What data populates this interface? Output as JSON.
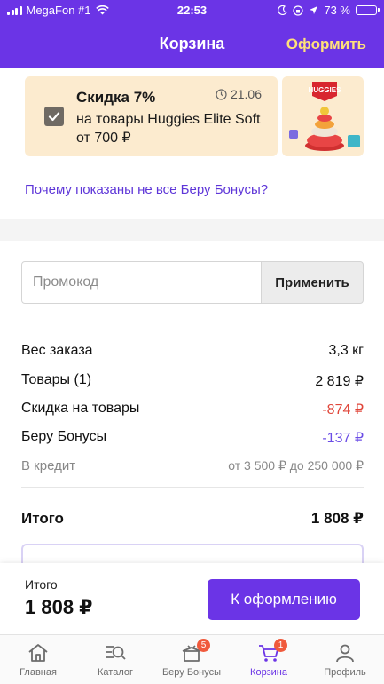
{
  "status_bar": {
    "carrier": "MegaFon #1",
    "time": "22:53",
    "battery": "73 %",
    "battery_fraction": 0.73
  },
  "nav": {
    "title": "Корзина",
    "action": "Оформить"
  },
  "promo": {
    "checked": true,
    "title": "Скидка 7%",
    "date": "21.06",
    "description": "на товары Huggies Elite Soft от 700 ₽",
    "brand": "HUGGIES"
  },
  "why_link": "Почему показаны не все Беру Бонусы?",
  "promo_code": {
    "placeholder": "Промокод",
    "value": "",
    "apply_label": "Применить"
  },
  "summary": {
    "rows": [
      {
        "label": "Вес заказа",
        "value": "3,3 кг"
      },
      {
        "label": "Товары (1)",
        "value": "2 819 ₽"
      },
      {
        "label": "Скидка на товары",
        "value": "-874 ₽"
      },
      {
        "label": "Беру Бонусы",
        "value": "-137 ₽"
      },
      {
        "label": "В кредит",
        "value": "от 3 500 ₽ до 250 000 ₽"
      }
    ],
    "total_label": "Итого",
    "total_value": "1 808 ₽"
  },
  "checkout": {
    "label": "Итого",
    "sum": "1 808 ₽",
    "button": "К оформлению"
  },
  "tabs": [
    {
      "label": "Главная",
      "icon": "home-icon"
    },
    {
      "label": "Каталог",
      "icon": "catalog-search-icon"
    },
    {
      "label": "Беру Бонусы",
      "icon": "gift-box-icon",
      "badge": "5"
    },
    {
      "label": "Корзина",
      "icon": "cart-icon",
      "badge": "1",
      "active": true
    },
    {
      "label": "Профиль",
      "icon": "profile-icon"
    }
  ],
  "colors": {
    "brand": "#6b34e6",
    "accent_yellow": "#ffe17a",
    "discount_red": "#e0463a",
    "bonus_violet": "#6b4de6",
    "promo_bg": "#fcebcf"
  }
}
